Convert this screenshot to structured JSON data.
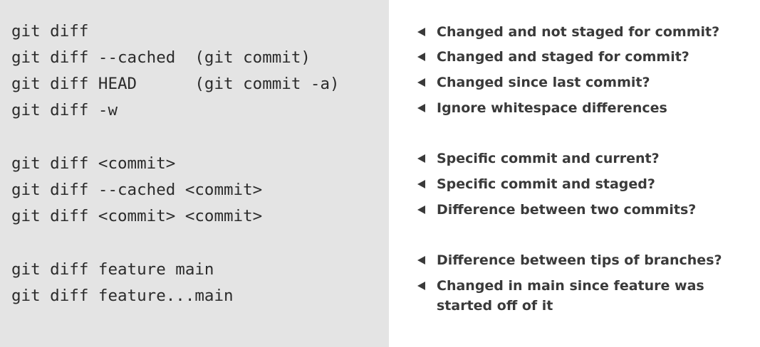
{
  "commands": [
    "git diff",
    "git diff --cached  (git commit)",
    "git diff HEAD      (git commit -a)",
    "git diff -w",
    "git diff <commit>",
    "git diff --cached <commit>",
    "git diff <commit> <commit>",
    "git diff feature main",
    "git diff feature...main"
  ],
  "descriptions": [
    "Changed and not staged for commit?",
    "Changed and staged for commit?",
    "Changed since last commit?",
    "Ignore whitespace differences",
    "Specific commit and current?",
    "Specific commit and staged?",
    "Difference between two commits?",
    "Difference between tips of branches?",
    "Changed in main since feature was started off of it"
  ],
  "colors": {
    "left_background": "#e4e4e4",
    "right_background": "#ffffff",
    "command_text": "#2b2b2b",
    "description_text": "#3a3a3a"
  },
  "icons": {
    "bullet": "triangle-left-icon"
  }
}
